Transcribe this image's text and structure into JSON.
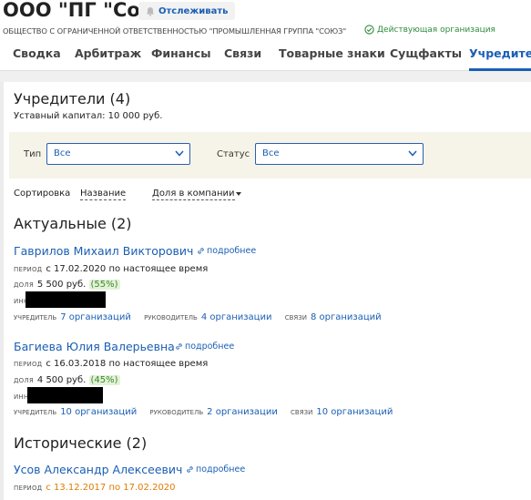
{
  "header": {
    "title": "ООО \"ПГ \"Союз\"",
    "watch_label": "Отслеживать",
    "full_name": "ОБЩЕСТВО С ОГРАНИЧЕННОЙ ОТВЕТСТВЕННОСТЬЮ \"ПРОМЫШЛЕННАЯ ГРУППА \"СОЮЗ\"",
    "status": "Действующая организация",
    "status_color": "#2e8b3a"
  },
  "tabs": [
    {
      "label": "Сводка"
    },
    {
      "label": "Арбитраж"
    },
    {
      "label": "Финансы"
    },
    {
      "label": "Связи"
    },
    {
      "label": "Товарные знаки"
    },
    {
      "label": "Сущфакты"
    },
    {
      "label": "Учредители"
    }
  ],
  "founders": {
    "title": "Учредители (4)",
    "capital": "Уставный капитал: 10 000 руб.",
    "filters": {
      "type_label": "Тип",
      "type_value": "Все",
      "status_label": "Статус",
      "status_value": "Все"
    },
    "sort": {
      "label": "Сортировка",
      "by_name": "Название",
      "by_share": "Доля в компании"
    },
    "actual_title": "Актуальные (2)",
    "historic_title": "Исторические (2)",
    "more_label": "подробнее",
    "labels": {
      "period": "период",
      "share": "доля",
      "inn": "инн",
      "founder": "учредитель",
      "head": "руководитель",
      "links": "связи"
    },
    "people": [
      {
        "name": "Гаврилов Михаил Викторович",
        "period": "с 17.02.2020 по настоящее время",
        "share": "5 500 руб.",
        "share_pct": "(55%)",
        "founder_orgs": "7 организаций",
        "head_orgs": "4 организации",
        "link_orgs": "8 организаций"
      },
      {
        "name": "Багиева Юлия Валерьевна",
        "period": "с 16.03.2018 по настоящее время",
        "share": "4 500 руб.",
        "share_pct": "(45%)",
        "founder_orgs": "10 организаций",
        "head_orgs": "2 организации",
        "link_orgs": "10 организаций"
      }
    ],
    "historic": [
      {
        "name": "Усов Александр Алексеевич",
        "period": "с 13.12.2017 по 17.02.2020"
      }
    ]
  },
  "colors": {
    "accent": "#1a5fb4",
    "filter_bg": "#f6f4e8",
    "pct_bg": "#e3f2d9",
    "historic_period": "#e07b00"
  }
}
